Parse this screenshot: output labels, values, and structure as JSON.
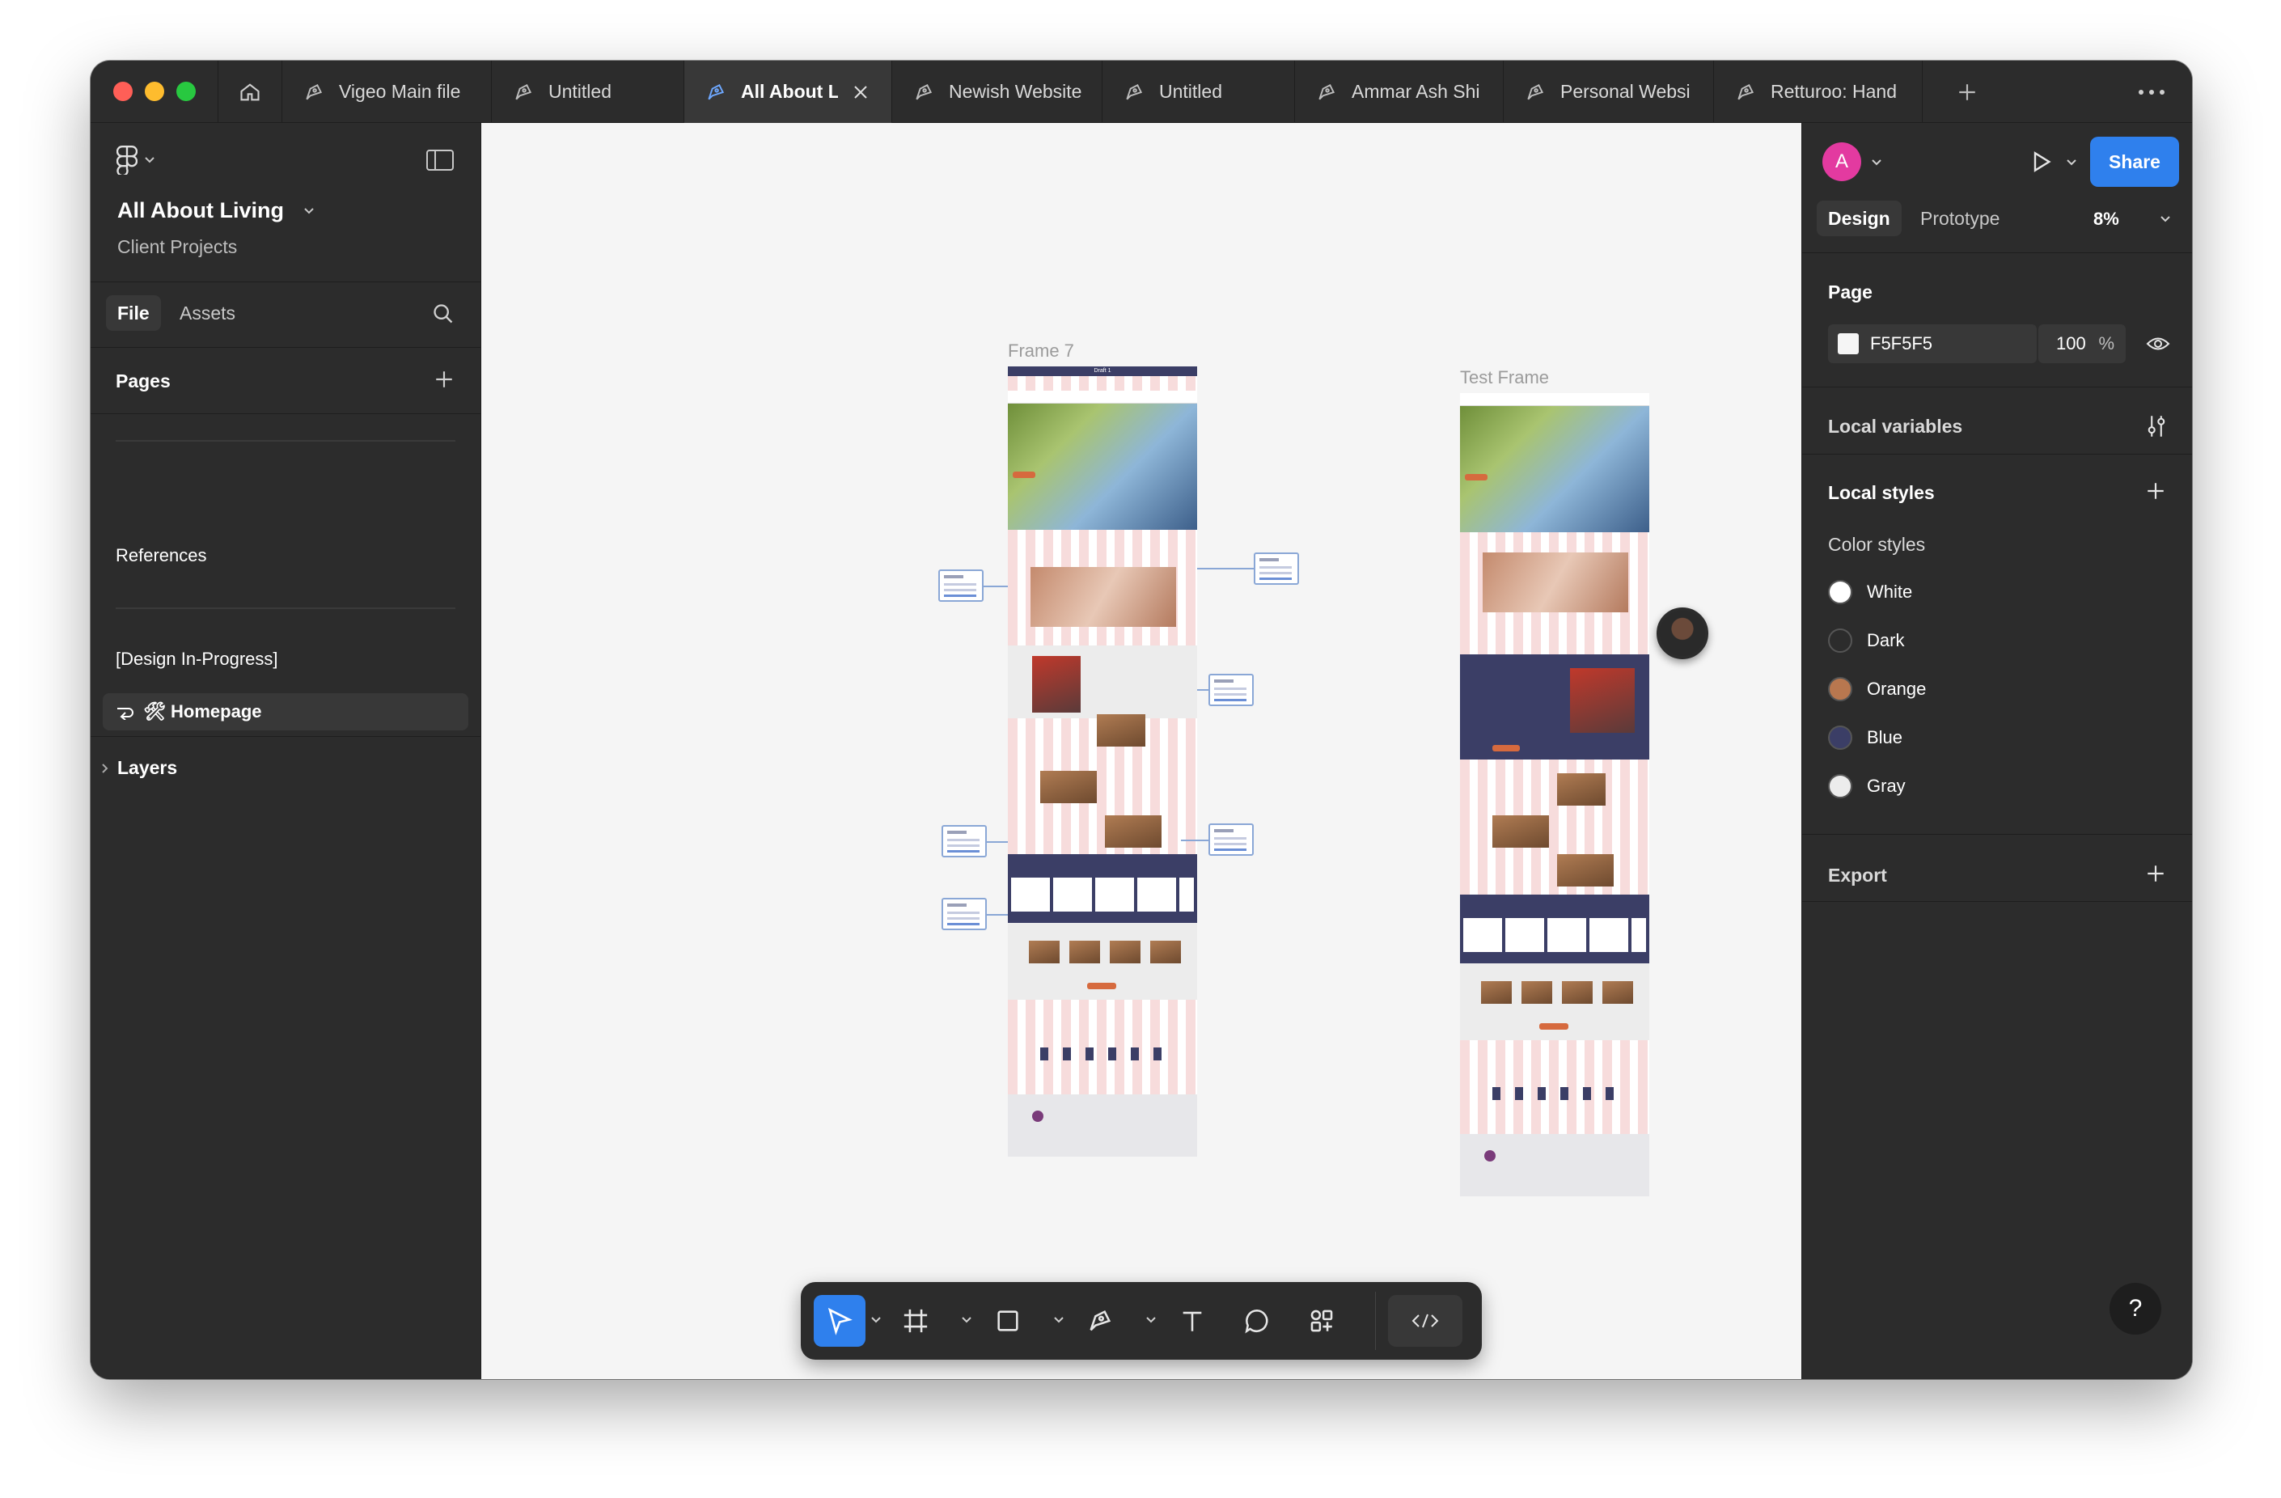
{
  "tabs": [
    {
      "label": "Vigeo Main file"
    },
    {
      "label": "Untitled"
    },
    {
      "label": "All About L"
    },
    {
      "label": "Newish Website"
    },
    {
      "label": "Untitled"
    },
    {
      "label": "Ammar Ash Shi"
    },
    {
      "label": "Personal Websi"
    },
    {
      "label": "Retturoo: Hand"
    }
  ],
  "left_panel": {
    "file_name": "All About Living",
    "project": "Client Projects",
    "file_tab": "File",
    "assets_tab": "Assets",
    "pages_label": "Pages",
    "pages": [
      "References",
      "[Design In-Progress]"
    ],
    "current_page": "🛠 Homepage",
    "layers_label": "Layers"
  },
  "canvas": {
    "frame_a_label": "Frame 7",
    "frame_a_title": "Draft 1",
    "frame_b_label": "Test Frame",
    "background": "#f5f5f5"
  },
  "right_panel": {
    "avatar_letter": "A",
    "share_label": "Share",
    "design_tab": "Design",
    "prototype_tab": "Prototype",
    "zoom": "8%",
    "page_label": "Page",
    "page_fill_hex": "F5F5F5",
    "page_opacity": "100",
    "percent_sign": "%",
    "local_variables": "Local variables",
    "local_styles": "Local styles",
    "color_styles_label": "Color styles",
    "color_styles": [
      {
        "name": "White",
        "color": "#ffffff"
      },
      {
        "name": "Dark",
        "color": "#2c2c2c"
      },
      {
        "name": "Orange",
        "color": "#b8774f"
      },
      {
        "name": "Blue",
        "color": "#3b3e66"
      },
      {
        "name": "Gray",
        "color": "#ececec"
      }
    ],
    "export_label": "Export",
    "help_label": "?"
  },
  "colors": {
    "accent": "#2f80ed",
    "panel": "#2c2c2c",
    "active_tab": "#383838"
  }
}
